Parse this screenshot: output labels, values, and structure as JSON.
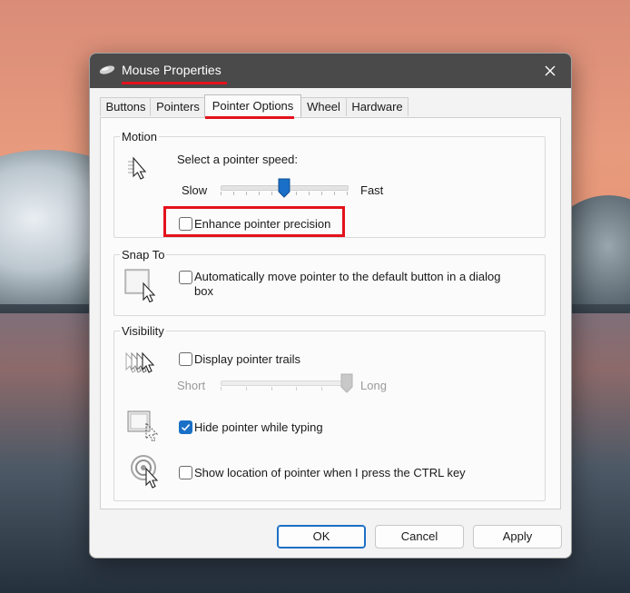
{
  "window": {
    "title": "Mouse Properties",
    "close_glyph": "✕"
  },
  "tabs": [
    {
      "label": "Buttons"
    },
    {
      "label": "Pointers"
    },
    {
      "label": "Pointer Options",
      "active": true
    },
    {
      "label": "Wheel"
    },
    {
      "label": "Hardware"
    }
  ],
  "motion": {
    "title": "Motion",
    "speed_label": "Select a pointer speed:",
    "slow_label": "Slow",
    "fast_label": "Fast",
    "speed_value": 0.5,
    "enhance_label": "Enhance pointer precision",
    "enhance_checked": false
  },
  "snap": {
    "title": "Snap To",
    "line1": "Automatically move pointer to the default button in a dialog",
    "line2": "box",
    "checked": false
  },
  "visibility": {
    "title": "Visibility",
    "trails_label": "Display pointer trails",
    "trails_checked": false,
    "short_label": "Short",
    "long_label": "Long",
    "trail_value": 1.0,
    "hide_label": "Hide pointer while typing",
    "hide_checked": true,
    "show_location_label": "Show location of pointer when I press the CTRL key",
    "show_location_checked": false
  },
  "buttons": {
    "ok": "OK",
    "cancel": "Cancel",
    "apply": "Apply"
  },
  "colors": {
    "accent": "#1a6fc6",
    "highlight": "#e3121b",
    "titlebar": "#4a4a4a"
  },
  "icons": [
    "mouse-icon",
    "close-icon",
    "pointer-speed-icon",
    "snap-to-icon",
    "pointer-trails-icon",
    "hide-pointer-icon",
    "show-location-icon",
    "checkmark-icon",
    "slider-thumb-icon"
  ]
}
